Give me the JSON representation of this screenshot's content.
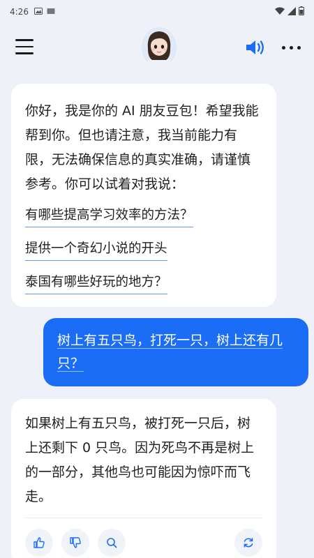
{
  "status_bar": {
    "time": "4:26"
  },
  "header": {
    "menu_icon": "hamburger-menu-icon",
    "speaker_icon": "speaker-icon",
    "more_icon": "more-dots-icon"
  },
  "messages": {
    "bot_intro": {
      "text": "你好，我是你的 AI 朋友豆包！希望我能帮到你。但也请注意，我当前能力有限，无法确保信息的真实准确，请谨慎参考。你可以试着对我说：",
      "suggestions": [
        "有哪些提高学习效率的方法？",
        "提供一个奇幻小说的开头",
        "泰国有哪些好玩的地方？"
      ]
    },
    "user_question": "树上有五只鸟，打死一只，树上还有几只？",
    "bot_answer": "如果树上有五只鸟，被打死一只后，树上还剩下 0 只鸟。因为死鸟不再是树上的一部分，其他鸟也可能因为惊吓而飞走。"
  },
  "colors": {
    "accent": "#1b6df5",
    "background": "#eef2f8",
    "bubble": "#ffffff"
  }
}
